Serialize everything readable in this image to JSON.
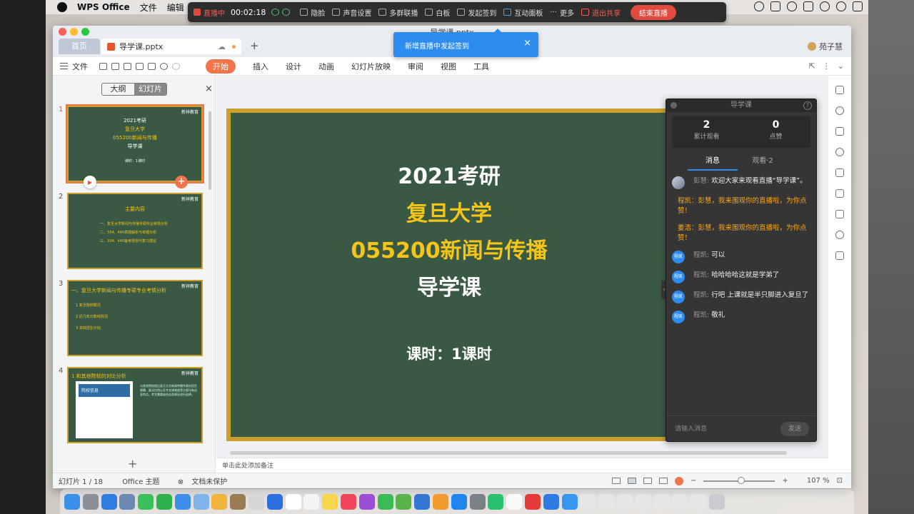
{
  "menubar": {
    "app": "WPS Office",
    "items": [
      "文件",
      "编辑"
    ]
  },
  "livebar": {
    "status": "直播中",
    "time": "00:02:18",
    "items": [
      "隐脸",
      "声音设置",
      "多群联播",
      "白板",
      "发起签到",
      "互动面板",
      "更多",
      "退出共享"
    ],
    "end_button": "结束直播"
  },
  "window": {
    "title": "导学课.pptx",
    "tab_home": "首页",
    "tab_doc": "导学课.pptx",
    "user": "苑子慧"
  },
  "toolbar": {
    "file": "文件",
    "ribbon": [
      "开始",
      "插入",
      "设计",
      "动画",
      "幻灯片放映",
      "审阅",
      "视图",
      "工具"
    ]
  },
  "toast": {
    "text": "新增直播中发起签到"
  },
  "panel": {
    "outline": "大纲",
    "slides": "幻灯片"
  },
  "thumbs": {
    "logo": "新祥教育",
    "t1": {
      "num": "1",
      "l1": "2021考研",
      "l2": "复旦大学",
      "l3": "055200新闻与传播",
      "l4": "导学课",
      "l5": "课时：1课时"
    },
    "t2": {
      "num": "2",
      "title": "主要内容",
      "items": [
        "一、复旦大学新闻与传播专硕专业考情分析",
        "二、334、440真题解析与考题分析",
        "三、334、440备考规划与复习建议"
      ]
    },
    "t3": {
      "num": "3",
      "title": "一、复旦大学新闻与传播专硕专业考情分析",
      "items": [
        "1 复旦院校概况",
        "2 近几年分数线情况",
        "3 本校招生计划"
      ]
    },
    "t4": {
      "num": "4",
      "title": "1 和其他院校的对比分析",
      "img_title": "院校信息",
      "text": "与其他院校相比复旦大学新闻传播专硕在招生规模、复试比例以及专业课难度等方面均有自身特点，考生需要结合自身情况进行选择。"
    }
  },
  "slide": {
    "l1": "2021考研",
    "l2": "复旦大学",
    "l3": "055200新闻与传播",
    "l4": "导学课",
    "l5": "课时：1课时"
  },
  "notes": "单击此处添加备注",
  "status": {
    "slide": "幻灯片 1 / 18",
    "theme": "Office 主题",
    "protect": "文档未保护",
    "zoom": "107 %"
  },
  "chat": {
    "title": "导学课",
    "views": "2",
    "views_label": "累计观看",
    "likes": "0",
    "likes_label": "点赞",
    "tab_msg": "消息",
    "tab_view": "观看·2",
    "messages": [
      {
        "name": "彭慧:",
        "text": "欢迎大家来观看直播“导学课”。"
      },
      {
        "sys": "程凯：彭慧，我来围观你的直播啦，为你点赞！"
      },
      {
        "sys": "姜浩：彭慧，我来围观你的直播啦，为你点赞！"
      },
      {
        "avatar": "程凯",
        "name": "程凯:",
        "text": "可以"
      },
      {
        "avatar": "程凯",
        "name": "程凯:",
        "text": "哈哈哈哈这就是学弟了"
      },
      {
        "avatar": "程凯",
        "name": "程凯:",
        "text": "行吧 上课就是半只脚进入复旦了"
      },
      {
        "avatar": "程凯",
        "name": "程凯:",
        "text": "敬礼"
      }
    ],
    "input_placeholder": "请输入消息",
    "send": "发送"
  },
  "colors": {
    "accent": "#f2744a",
    "slide_bg": "#3a5944",
    "slide_border": "#c9a02a",
    "gold_text": "#f5c518",
    "live_red": "#e14a3e",
    "toast": "#2d8cf0"
  }
}
